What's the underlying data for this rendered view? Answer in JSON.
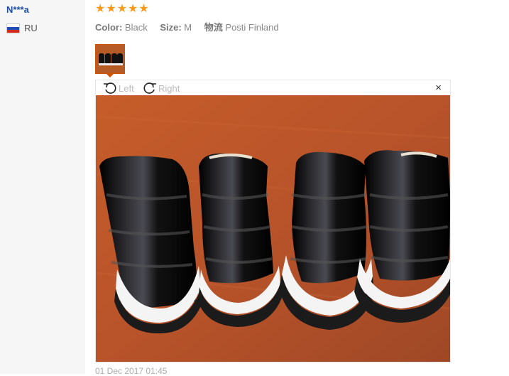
{
  "review": {
    "buyer_name": "N***a",
    "country_code": "RU",
    "rating": 5,
    "rating_icon": "star-icon",
    "color_label": "Color:",
    "color_value": "Black",
    "size_label": "Size:",
    "size_value": "M",
    "logistics_label": "物流",
    "logistics_value": "Posti Finland",
    "date_partial": "01 Dec 2017 01:45"
  },
  "viewer": {
    "rotate_left_label": "Left",
    "rotate_right_label": "Right",
    "close_label": "×"
  },
  "colors": {
    "accent_star": "#f59a1b",
    "buyer_link": "#1e4fa3",
    "thumb_border": "#d35400"
  }
}
